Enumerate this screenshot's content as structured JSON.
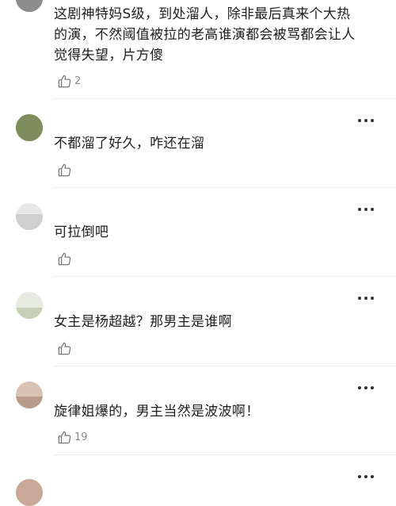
{
  "comments": [
    {
      "text": "这剧神特妈S级，到处溜人，除非最后真来个大热\n的演，不然阈值被拉的老高谁演都会被骂都会让人\n觉得失望，片方傻",
      "like_count": "2"
    },
    {
      "text": "不都溜了好久，咋还在溜",
      "like_count": ""
    },
    {
      "text": "可拉倒吧",
      "like_count": ""
    },
    {
      "text": "女主是杨超越？那男主是谁啊",
      "like_count": ""
    },
    {
      "text": "旋律姐爆的，男主当然是波波啊！",
      "like_count": "19"
    }
  ],
  "icons": {
    "like": "thumbs-up-icon",
    "more": "more-dots-icon"
  },
  "colors": {
    "text": "#1e1e1e",
    "muted": "#8a8a8a",
    "divider": "#ececec"
  }
}
